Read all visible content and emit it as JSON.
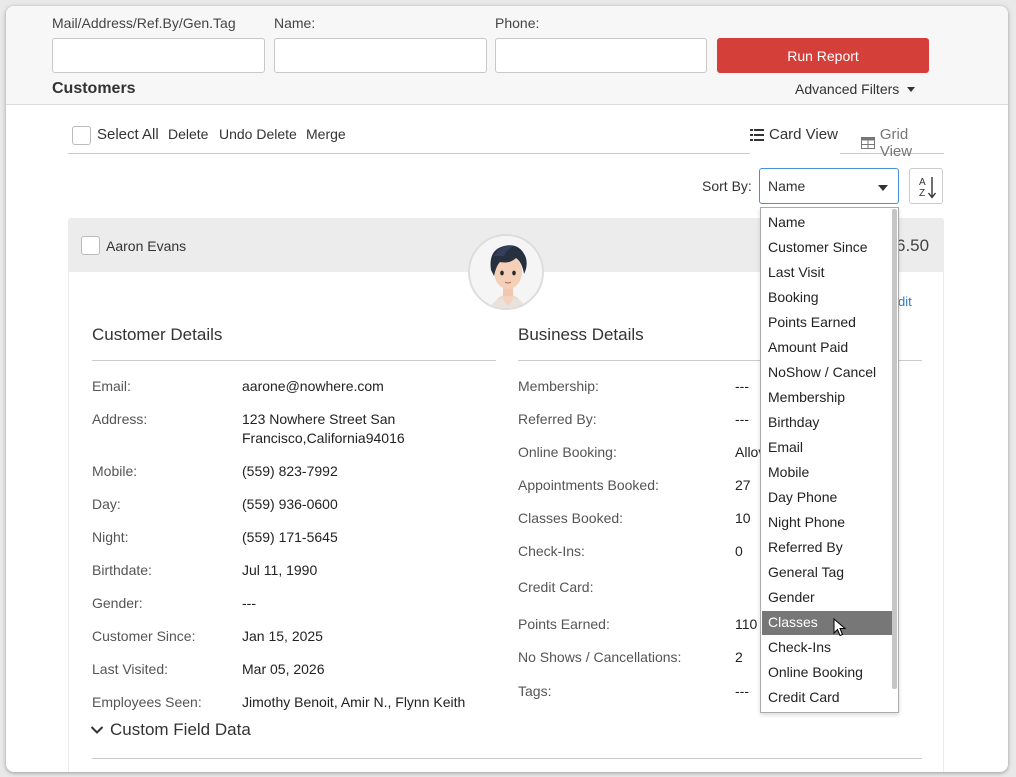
{
  "filters": {
    "mail_label": "Mail/Address/Ref.By/Gen.Tag",
    "name_label": "Name:",
    "phone_label": "Phone:",
    "run_report": "Run Report",
    "section_title": "Customers",
    "advanced_filters": "Advanced Filters"
  },
  "toolbar": {
    "select_all": "Select All",
    "delete": "Delete",
    "undo_delete": "Undo Delete",
    "merge": "Merge",
    "card_view": "Card View",
    "grid_view": "Grid View"
  },
  "sort": {
    "label": "Sort By:",
    "selected": "Name",
    "options": [
      "Name",
      "Customer Since",
      "Last Visit",
      "Booking",
      "Points Earned",
      "Amount Paid",
      "NoShow / Cancel",
      "Membership",
      "Birthday",
      "Email",
      "Mobile",
      "Day Phone",
      "Night Phone",
      "Referred By",
      "General Tag",
      "Gender",
      "Classes",
      "Check-Ins",
      "Online Booking",
      "Credit Card"
    ],
    "hovered_option": "Classes"
  },
  "card": {
    "customer_name": "Aaron Evans",
    "amount_partial": "6.50",
    "edit_partial": "dit",
    "customer_details_title": "Customer Details",
    "business_details_title": "Business Details",
    "customer_details": [
      {
        "label": "Email:",
        "value": "aarone@nowhere.com"
      },
      {
        "label": "Address:",
        "value": "123 Nowhere Street San",
        "value2": "Francisco,California94016"
      },
      {
        "label": "Mobile:",
        "value": "(559) 823-7992"
      },
      {
        "label": "Day:",
        "value": "(559) 936-0600"
      },
      {
        "label": "Night:",
        "value": "(559) 171-5645"
      },
      {
        "label": "Birthdate:",
        "value": "Jul 11, 1990"
      },
      {
        "label": "Gender:",
        "value": "---"
      },
      {
        "label": "Customer Since:",
        "value": "Jan 15, 2025"
      },
      {
        "label": "Last Visited:",
        "value": "Mar 05, 2026"
      },
      {
        "label": "Employees Seen:",
        "value": "Jimothy Benoit, Amir N., Flynn Keith"
      }
    ],
    "business_details": [
      {
        "label": "Membership:",
        "value": "---"
      },
      {
        "label": "Referred By:",
        "value": "---"
      },
      {
        "label": "Online Booking:",
        "value": "Allov"
      },
      {
        "label": "Appointments Booked:",
        "value": "27"
      },
      {
        "label": "Classes Booked:",
        "value": "10"
      },
      {
        "label": "Check-Ins:",
        "value": "0"
      },
      {
        "label": "Credit Card:",
        "value": ""
      },
      {
        "label": "Points Earned:",
        "value": "110"
      },
      {
        "label": "No Shows / Cancellations:",
        "value": "2"
      },
      {
        "label": "Tags:",
        "value": "---"
      }
    ],
    "custom_field_data": "Custom Field Data"
  },
  "colors": {
    "run_button": "#d43f3a",
    "link_blue": "#2a7fc9",
    "dropdown_selected": "#777777"
  }
}
